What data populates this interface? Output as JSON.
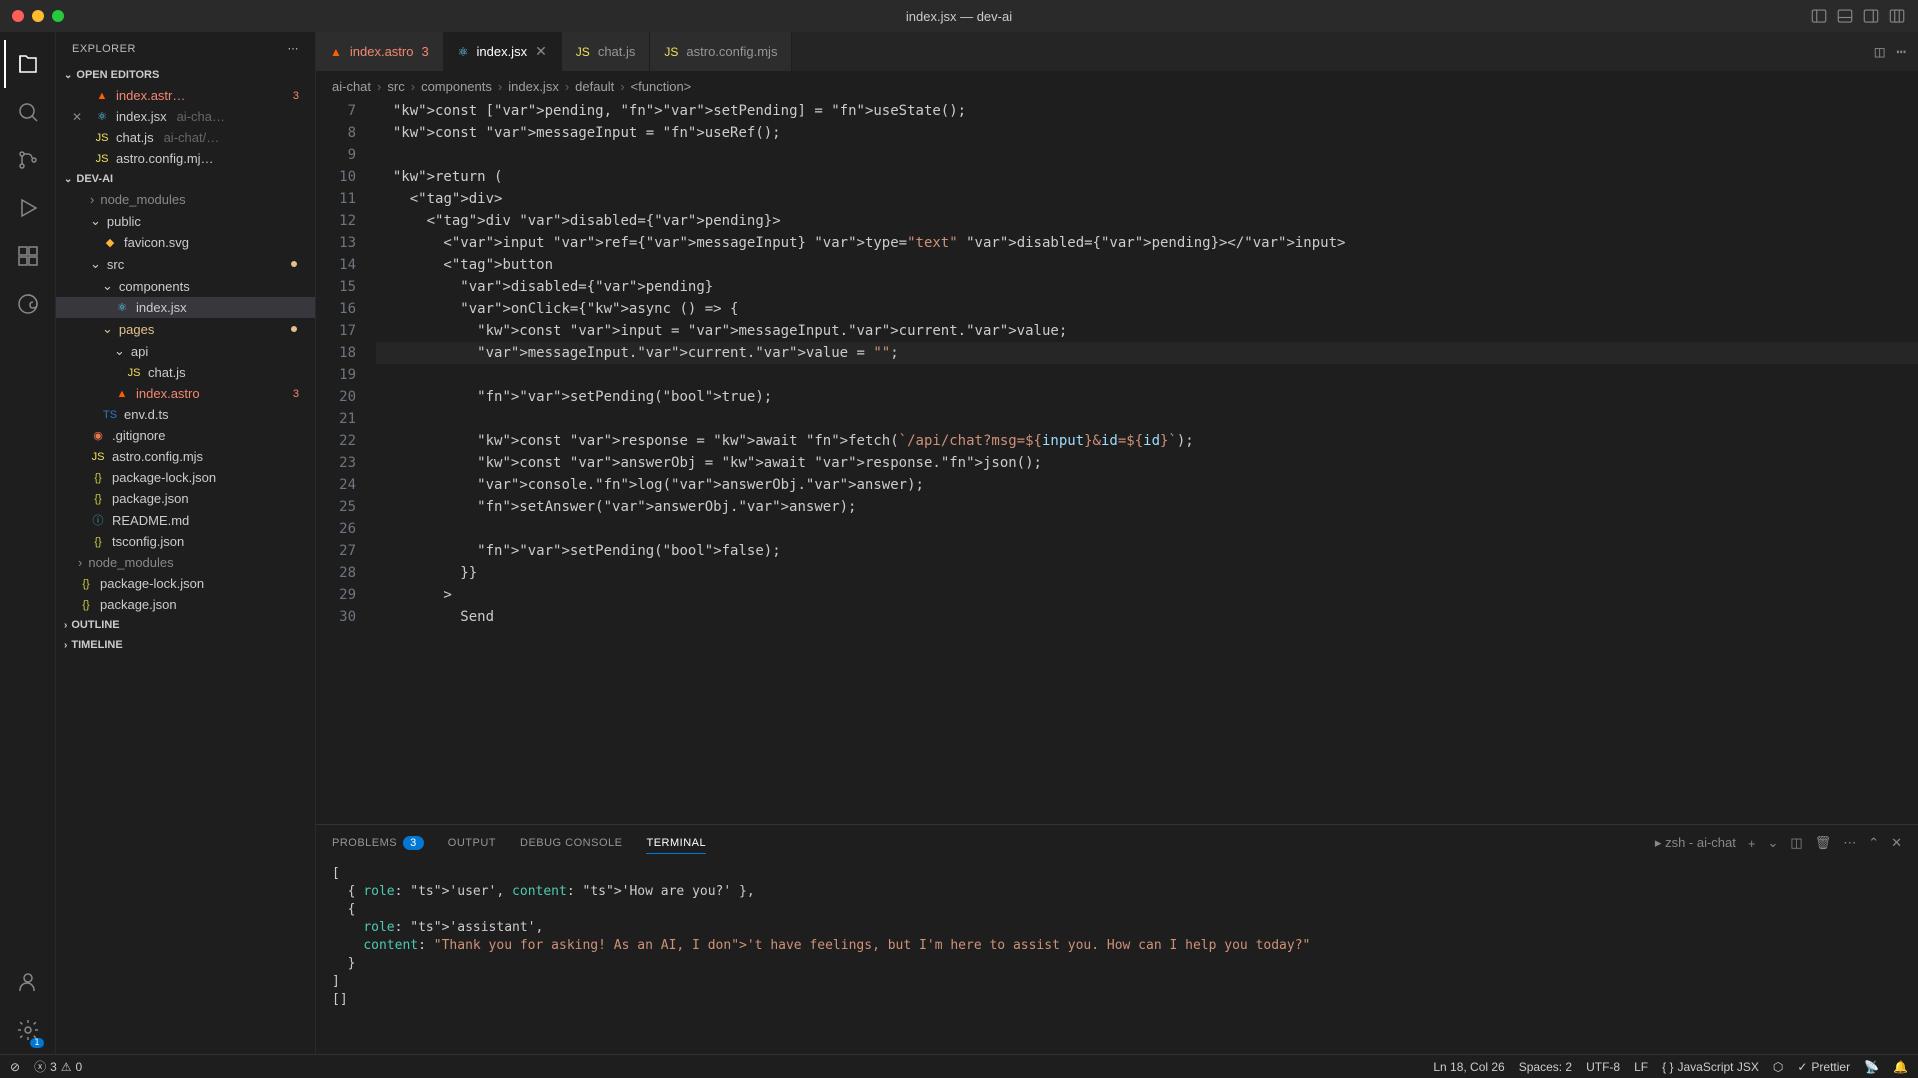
{
  "window": {
    "title": "index.jsx — dev-ai"
  },
  "sidebar": {
    "header": "EXPLORER",
    "sections": {
      "openEditors": "OPEN EDITORS",
      "project": "DEV-AI",
      "outline": "OUTLINE",
      "timeline": "TIMELINE"
    },
    "openEditors": [
      {
        "name": "index.astr…",
        "badge": "3",
        "icon": "astro"
      },
      {
        "name": "index.jsx",
        "hint": "ai-cha…",
        "icon": "react",
        "close": true
      },
      {
        "name": "chat.js",
        "hint": "ai-chat/…",
        "icon": "js"
      },
      {
        "name": "astro.config.mj…",
        "icon": "js"
      }
    ],
    "tree": [
      {
        "indent": 1,
        "name": "node_modules",
        "type": "folder",
        "dim": true
      },
      {
        "indent": 1,
        "name": "public",
        "type": "folder",
        "open": true
      },
      {
        "indent": 2,
        "name": "favicon.svg",
        "type": "file",
        "icon": "svg"
      },
      {
        "indent": 1,
        "name": "src",
        "type": "folder",
        "open": true,
        "mod": true
      },
      {
        "indent": 2,
        "name": "components",
        "type": "folder",
        "open": true
      },
      {
        "indent": 3,
        "name": "index.jsx",
        "type": "file",
        "icon": "react",
        "selected": true
      },
      {
        "indent": 2,
        "name": "pages",
        "type": "folder",
        "open": true,
        "mod": true,
        "modcolor": true
      },
      {
        "indent": 3,
        "name": "api",
        "type": "folder",
        "open": true
      },
      {
        "indent": 4,
        "name": "chat.js",
        "type": "file",
        "icon": "js"
      },
      {
        "indent": 3,
        "name": "index.astro",
        "type": "file",
        "icon": "astro",
        "error": true,
        "badge": "3"
      },
      {
        "indent": 2,
        "name": "env.d.ts",
        "type": "file",
        "icon": "ts"
      },
      {
        "indent": 1,
        "name": ".gitignore",
        "type": "file",
        "icon": "git"
      },
      {
        "indent": 1,
        "name": "astro.config.mjs",
        "type": "file",
        "icon": "js"
      },
      {
        "indent": 1,
        "name": "package-lock.json",
        "type": "file",
        "icon": "json"
      },
      {
        "indent": 1,
        "name": "package.json",
        "type": "file",
        "icon": "json"
      },
      {
        "indent": 1,
        "name": "README.md",
        "type": "file",
        "icon": "md"
      },
      {
        "indent": 1,
        "name": "tsconfig.json",
        "type": "file",
        "icon": "json"
      },
      {
        "indent": 0,
        "name": "node_modules",
        "type": "folder",
        "dim": true
      },
      {
        "indent": 0,
        "name": "package-lock.json",
        "type": "file",
        "icon": "json"
      },
      {
        "indent": 0,
        "name": "package.json",
        "type": "file",
        "icon": "json"
      }
    ]
  },
  "tabs": [
    {
      "name": "index.astro",
      "icon": "astro",
      "badge": "3",
      "error": true
    },
    {
      "name": "index.jsx",
      "icon": "react",
      "active": true,
      "close": true
    },
    {
      "name": "chat.js",
      "icon": "js"
    },
    {
      "name": "astro.config.mjs",
      "icon": "js"
    }
  ],
  "breadcrumb": [
    "ai-chat",
    "src",
    "components",
    "index.jsx",
    "default",
    "<function>"
  ],
  "code": {
    "startLine": 7,
    "currentLine": 18,
    "lines": [
      "  const [pending, setPending] = useState();",
      "  const messageInput = useRef();",
      "",
      "  return (",
      "    <div>",
      "      <div disabled={pending}>",
      "        <input ref={messageInput} type=\"text\" disabled={pending}></input>",
      "        <button",
      "          disabled={pending}",
      "          onClick={async () => {",
      "            const input = messageInput.current.value;",
      "            messageInput.current.value = \"\";",
      "",
      "            setPending(true);",
      "",
      "            const response = await fetch(`/api/chat?msg=${input}&id=${id}`);",
      "            const answerObj = await response.json();",
      "            console.log(answerObj.answer);",
      "            setAnswer(answerObj.answer);",
      "",
      "            setPending(false);",
      "          }}",
      "        >",
      "          Send"
    ]
  },
  "panel": {
    "tabs": {
      "problems": "PROBLEMS",
      "problemsCount": "3",
      "output": "OUTPUT",
      "debug": "DEBUG CONSOLE",
      "terminal": "TERMINAL"
    },
    "terminalLabel": "zsh - ai-chat",
    "terminalLines": [
      "[",
      "  { role: 'user', content: 'How are you?' },",
      "  {",
      "    role: 'assistant',",
      "    content: \"Thank you for asking! As an AI, I don't have feelings, but I'm here to assist you. How can I help you today?\"",
      "  }",
      "]",
      "[]"
    ]
  },
  "statusbar": {
    "errors": "3",
    "warnings": "0",
    "ln": "Ln 18, Col 26",
    "spaces": "Spaces: 2",
    "encoding": "UTF-8",
    "eol": "LF",
    "lang": "JavaScript JSX",
    "prettier": "Prettier",
    "settingsBadge": "1"
  }
}
